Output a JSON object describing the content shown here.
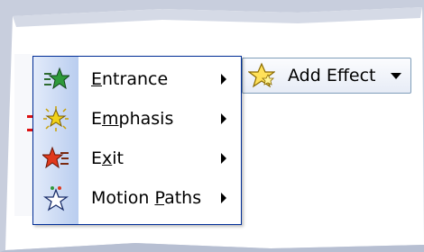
{
  "button": {
    "label": "Add Effect",
    "icon": "star-effect-icon"
  },
  "menu": {
    "items": [
      {
        "before": "",
        "key": "E",
        "after": "ntrance",
        "icon": "entrance-star-icon",
        "color": "#2e9a3a",
        "has_submenu": true
      },
      {
        "before": "E",
        "key": "m",
        "after": "phasis",
        "icon": "emphasis-star-icon",
        "color": "#f1d21a",
        "has_submenu": true
      },
      {
        "before": "E",
        "key": "x",
        "after": "it",
        "icon": "exit-star-icon",
        "color": "#e0391d",
        "has_submenu": true
      },
      {
        "before": "Motion ",
        "key": "P",
        "after": "aths",
        "icon": "motion-path-star-icon",
        "color": "#ffffff",
        "has_submenu": true
      }
    ]
  }
}
